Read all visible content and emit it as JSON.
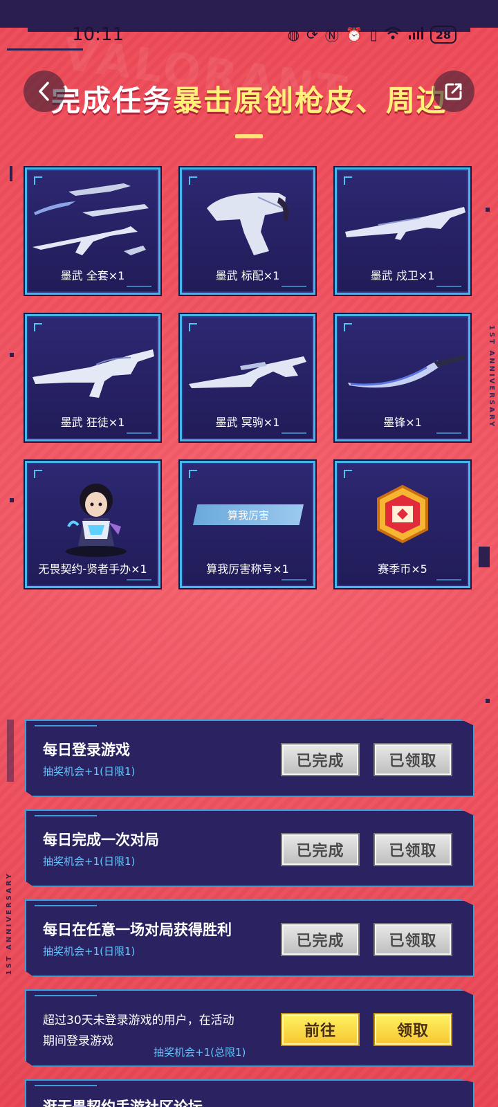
{
  "status_bar": {
    "time": "10:11",
    "icons": [
      "app-icon",
      "sync-icon",
      "n-icon",
      "alarm-icon",
      "vibrate-icon",
      "wifi-icon",
      "signal-icon"
    ],
    "battery": "28"
  },
  "header": {
    "title_white": "完成任务",
    "title_yellow": "暴击原创枪皮、周边",
    "back_icon": "chevron-left-icon",
    "share_icon": "share-icon"
  },
  "background": {
    "watermark": "VALORANT",
    "side_text": "1ST ANNIVERSARY"
  },
  "rewards": [
    {
      "label": "墨武 全套×1",
      "icon": "weapon-set-icon"
    },
    {
      "label": "墨武 标配×1",
      "icon": "pistol-icon"
    },
    {
      "label": "墨武 戍卫×1",
      "icon": "rifle-icon"
    },
    {
      "label": "墨武 狂徒×1",
      "icon": "rifle-icon"
    },
    {
      "label": "墨武 冥驹×1",
      "icon": "sniper-icon"
    },
    {
      "label": "墨锋×1",
      "icon": "knife-icon"
    },
    {
      "label": "无畏契约-贤者手办×1",
      "icon": "figure-icon"
    },
    {
      "label": "算我厉害称号×1",
      "icon": "title-badge-icon",
      "tag": "算我厉害"
    },
    {
      "label": "赛季币×5",
      "icon": "coin-icon"
    }
  ],
  "tasks": [
    {
      "title": "每日登录游戏",
      "sub": "抽奖机会+1(日限1)",
      "btn1": "已完成",
      "btn2": "已领取"
    },
    {
      "title": "每日完成一次对局",
      "sub": "抽奖机会+1(日限1)",
      "btn1": "已完成",
      "btn2": "已领取"
    },
    {
      "title": "每日在任意一场对局获得胜利",
      "sub": "抽奖机会+1(日限1)",
      "btn1": "已完成",
      "btn2": "已领取"
    },
    {
      "title_line1": "超过30天未登录游戏的用户，在活动",
      "title_line2": "期间登录游戏",
      "sub": "抽奖机会+1(总限1)",
      "btn1": "前往",
      "btn2": "领取"
    },
    {
      "title": "逛无畏契约手游社区论坛"
    }
  ],
  "colors": {
    "background": "#f1515c",
    "card": "#2b2262",
    "accent_blue": "#43b8e8",
    "title_yellow": "#fff07a",
    "button_active": "#f7c531",
    "button_done": "#bdbdbd"
  }
}
